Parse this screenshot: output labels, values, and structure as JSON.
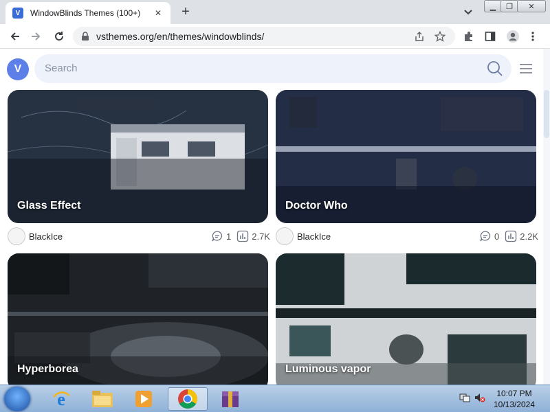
{
  "browser": {
    "tab_title": "WindowBlinds Themes (100+)",
    "tab_favicon_letter": "V",
    "url": "vsthemes.org/en/themes/windowblinds/"
  },
  "site": {
    "logo_letter": "V",
    "search_placeholder": "Search"
  },
  "cards": [
    {
      "title": "Glass Effect",
      "author": "BlackIce",
      "comments": "1",
      "views": "2.7K"
    },
    {
      "title": "Doctor Who",
      "author": "BlackIce",
      "comments": "0",
      "views": "2.2K"
    },
    {
      "title": "Hyperborea"
    },
    {
      "title": "Luminous vapor"
    }
  ],
  "taskbar": {
    "time": "10:07 PM",
    "date": "10/13/2024"
  }
}
